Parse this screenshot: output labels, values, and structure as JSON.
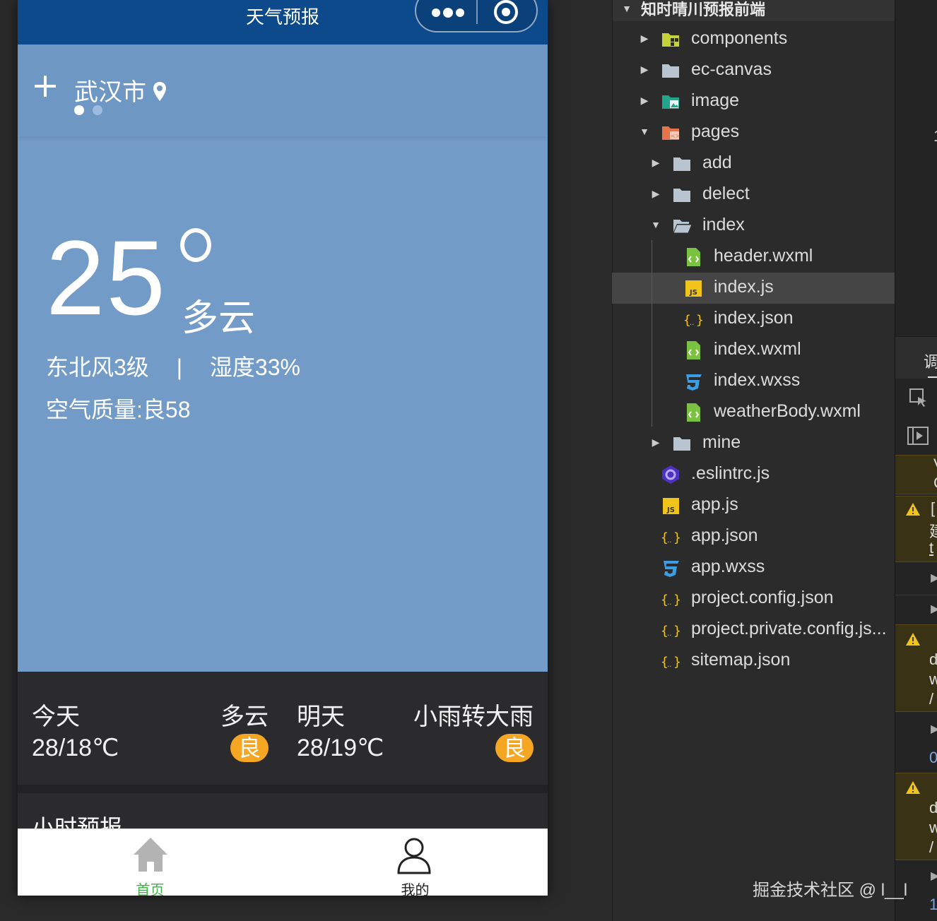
{
  "simulator": {
    "nav_title": "天气预报",
    "city": "武汉市",
    "temperature": "25",
    "weather": "多云",
    "wind": "东北风3级",
    "separator": "|",
    "humidity": "湿度33%",
    "air_quality": "空气质量:良58",
    "forecast": [
      {
        "day": "今天",
        "weather": "多云",
        "temp": "28/18℃",
        "aqi": "良"
      },
      {
        "day": "明天",
        "weather": "小雨转大雨",
        "temp": "28/19℃",
        "aqi": "良"
      }
    ],
    "hourly_title": "小时预报",
    "tabs": [
      {
        "label": "首页",
        "icon": "home-icon",
        "active": true
      },
      {
        "label": "我的",
        "icon": "user-icon",
        "active": false
      }
    ],
    "colors": {
      "navbar": "#0c4a8b",
      "hero": "#739bc7",
      "badge": "#f5a623",
      "tab_active": "#3cb043"
    }
  },
  "explorer": {
    "project_name": "知时晴川预报前端",
    "items": [
      {
        "name": "components",
        "icon": "components-folder-icon",
        "expanded": false
      },
      {
        "name": "ec-canvas",
        "icon": "folder-icon",
        "expanded": false
      },
      {
        "name": "image",
        "icon": "image-folder-icon",
        "expanded": false
      },
      {
        "name": "pages",
        "icon": "pages-folder-icon",
        "expanded": true
      },
      {
        "name": "add",
        "icon": "folder-icon",
        "expanded": false
      },
      {
        "name": "delect",
        "icon": "folder-icon",
        "expanded": false
      },
      {
        "name": "index",
        "icon": "folder-open-icon",
        "expanded": true
      },
      {
        "name": "header.wxml",
        "icon": "wxml-file-icon"
      },
      {
        "name": "index.js",
        "icon": "js-file-icon",
        "selected": true
      },
      {
        "name": "index.json",
        "icon": "json-file-icon"
      },
      {
        "name": "index.wxml",
        "icon": "wxml-file-icon"
      },
      {
        "name": "index.wxss",
        "icon": "wxss-file-icon"
      },
      {
        "name": "weatherBody.wxml",
        "icon": "wxml-file-icon"
      },
      {
        "name": "mine",
        "icon": "folder-icon",
        "expanded": false
      },
      {
        "name": ".eslintrc.js",
        "icon": "eslint-file-icon"
      },
      {
        "name": "app.js",
        "icon": "js-file-icon"
      },
      {
        "name": "app.json",
        "icon": "json-file-icon"
      },
      {
        "name": "app.wxss",
        "icon": "wxss-file-icon"
      },
      {
        "name": "project.config.json",
        "icon": "json-file-icon"
      },
      {
        "name": "project.private.config.js...",
        "icon": "json-file-icon"
      },
      {
        "name": "sitemap.json",
        "icon": "json-file-icon"
      }
    ]
  },
  "devtools": {
    "tab_char": "调",
    "fragments": [
      "1",
      "V",
      "C",
      "[",
      "建",
      "t",
      "d",
      "w",
      "/",
      "0",
      "d",
      "w",
      "/",
      "1"
    ]
  },
  "watermark": "掘金技术社区 @ l__l"
}
